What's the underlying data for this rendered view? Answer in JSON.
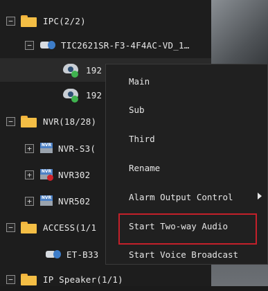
{
  "tree": {
    "ipc_group": "IPC(2/2)",
    "ipc_device": "TIC2621SR-F3-4F4AC-VD_1…",
    "channel_1": "192",
    "channel_2": "192",
    "nvr_group": "NVR(18/28)",
    "nvr_1": "NVR-S3(",
    "nvr_2": "NVR302",
    "nvr_3": "NVR502",
    "access_group": "ACCESS(1/1",
    "access_device": "ET-B33",
    "ip_speaker_group": "IP Speaker(1/1)",
    "expand_symbol": "+",
    "collapse_symbol": "−"
  },
  "context_menu": {
    "items": [
      "Main",
      "Sub",
      "Third",
      "Rename",
      "Alarm Output Control",
      "Start Two-way Audio",
      "Start Voice Broadcast"
    ]
  },
  "highlight_color": "#c4202a",
  "accent_color": "#f4be45"
}
